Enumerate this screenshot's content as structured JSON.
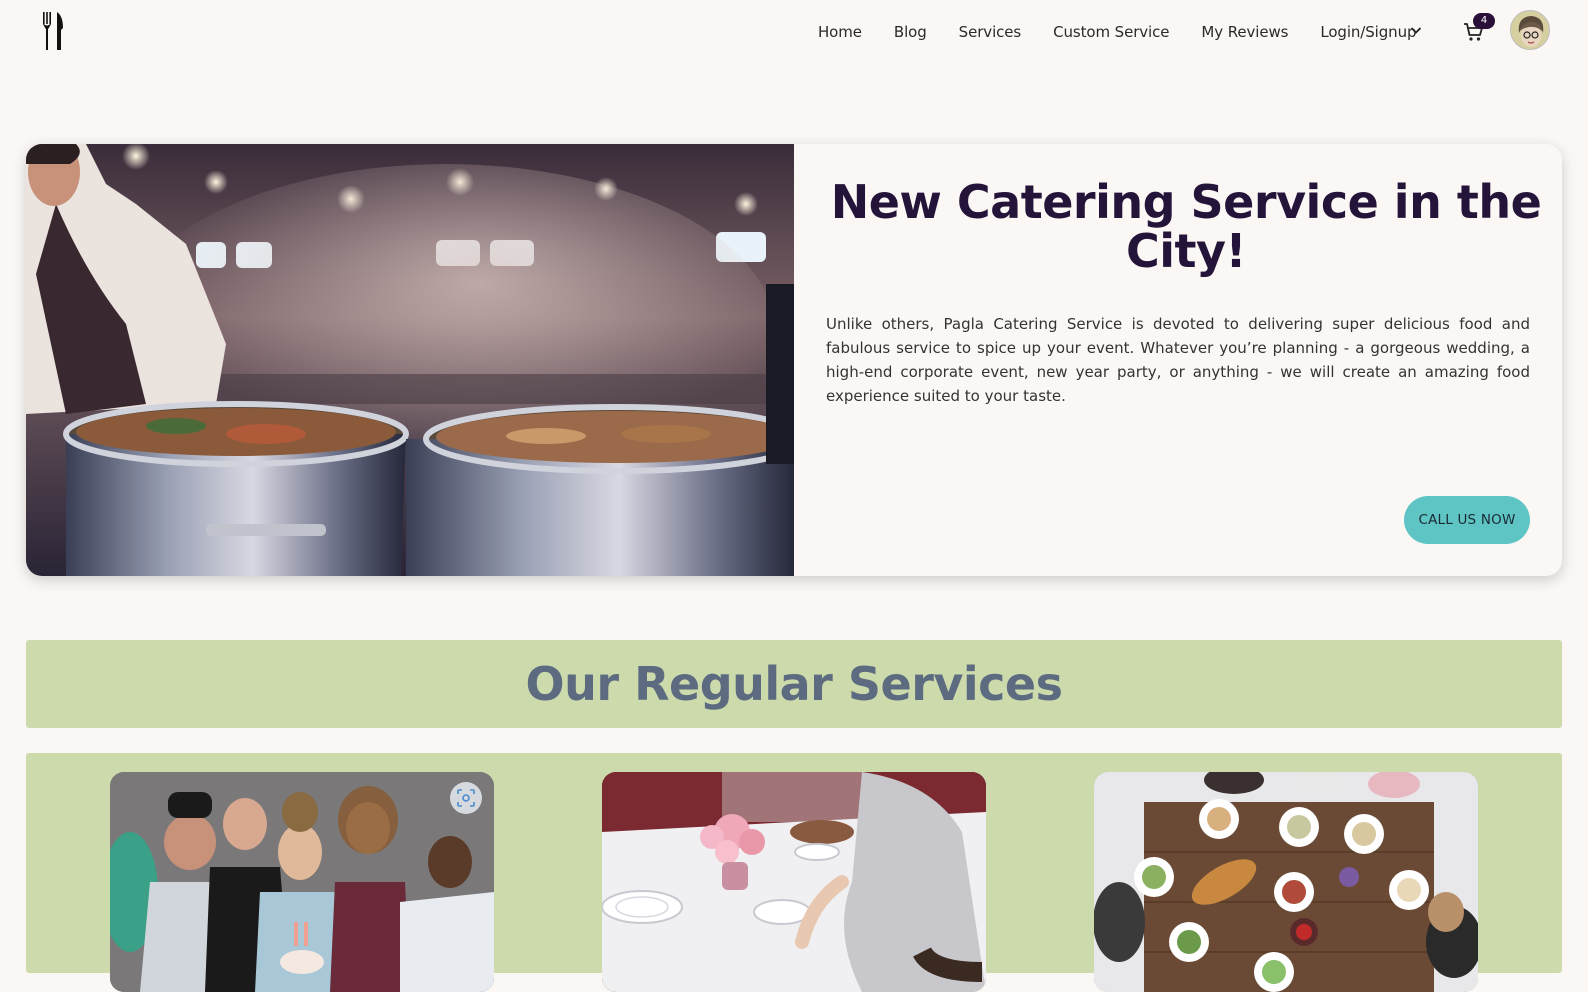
{
  "nav": {
    "links": [
      "Home",
      "Blog",
      "Services",
      "Custom Service",
      "My Reviews",
      "Login/Signup"
    ],
    "cart_count": "4",
    "icons": {
      "logo": "fork-knife-icon",
      "dropdown": "chevron-down-icon",
      "cart": "cart-icon"
    }
  },
  "hero": {
    "title": "New Catering Service in the City!",
    "description": "Unlike others, Pagla Catering Service is devoted to delivering super delicious food and fabulous service to spice up your event. Whatever you’re planning - a gorgeous wedding, a high-end corporate event, new year party, or anything - we will create an amazing food experience suited to your taste.",
    "cta_label": "CALL US NOW",
    "cta_color": "#5ec4c4"
  },
  "services": {
    "title": "Our Regular Services",
    "banner_color": "#cddbac"
  },
  "colors": {
    "page_bg": "#fbf7f5",
    "title_dark": "#24143a",
    "services_title": "#5d6b80"
  }
}
